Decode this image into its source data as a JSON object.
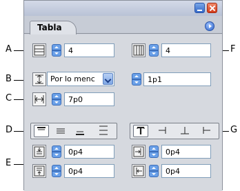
{
  "panel": {
    "tab_label": "Tabla",
    "menu_icon": "panel-menu-icon"
  },
  "callouts": {
    "a": "A",
    "b": "B",
    "c": "C",
    "d": "D",
    "e": "E",
    "f": "F",
    "g": "G"
  },
  "rows": {
    "body_rows_value": "4",
    "columns_value": "4",
    "row_height_mode": "Por lo menc",
    "row_height_value": "1p1",
    "column_width_value": "7p0"
  },
  "align": {
    "vertical_options": [
      "align-top",
      "align-center",
      "align-bottom",
      "justify-vertical"
    ],
    "vertical_selected": "align-top",
    "rotation_options": [
      "rotate-0",
      "rotate-90",
      "rotate-180",
      "rotate-270"
    ],
    "rotation_selected": "rotate-0"
  },
  "insets": {
    "top": "0p4",
    "bottom": "0p4",
    "left": "0p4",
    "right": "0p4"
  },
  "colors": {
    "spin_blue": "#6aa0e8",
    "close_red": "#d23a1a",
    "min_blue": "#3468c8"
  }
}
